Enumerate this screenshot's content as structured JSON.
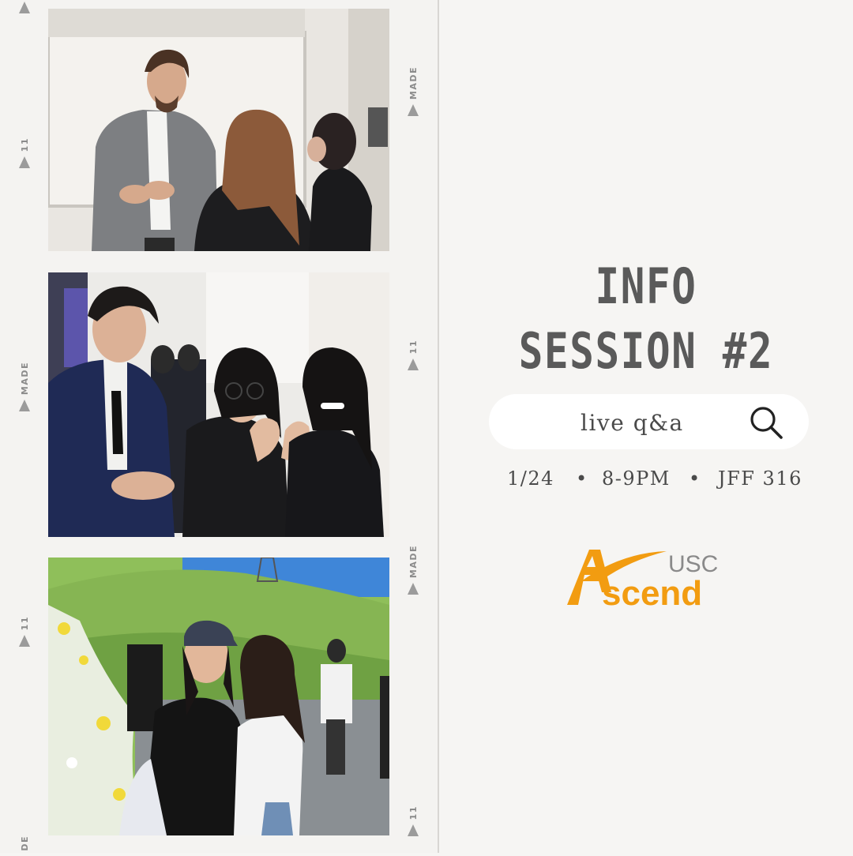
{
  "film_strip": {
    "marks": [
      {
        "text": "",
        "icon": "film-arrow-icon"
      },
      {
        "text": "MADE",
        "icon": "film-arrow-icon"
      },
      {
        "text": "11",
        "icon": "film-arrow-icon"
      },
      {
        "text": "11",
        "icon": "film-arrow-icon"
      },
      {
        "text": "MADE",
        "icon": "film-arrow-icon"
      },
      {
        "text": "11",
        "icon": "film-arrow-icon"
      },
      {
        "text": "MADE",
        "icon": "film-arrow-icon"
      },
      {
        "text": "11",
        "icon": "film-arrow-icon"
      },
      {
        "text": "DE",
        "icon": "film-arrow-icon"
      }
    ],
    "photos": [
      {
        "subject": "speaker talking with two students"
      },
      {
        "subject": "three members posing with hand gestures"
      },
      {
        "subject": "two friends smiling outdoors on a hillside"
      }
    ]
  },
  "event": {
    "title_line1": "INFO",
    "title_line2": "SESSION #2",
    "search_label": "live q&a",
    "search_icon": "search-icon",
    "date": "1/24",
    "separator": "•",
    "time": "8-9PM",
    "location": "JFF 316"
  },
  "logo": {
    "small_text": "USC",
    "main_text": "scend",
    "initial": "A",
    "color": "#f29c11"
  },
  "colors": {
    "background": "#f6f5f3",
    "text": "#5a5a5a",
    "accent": "#f29c11"
  }
}
